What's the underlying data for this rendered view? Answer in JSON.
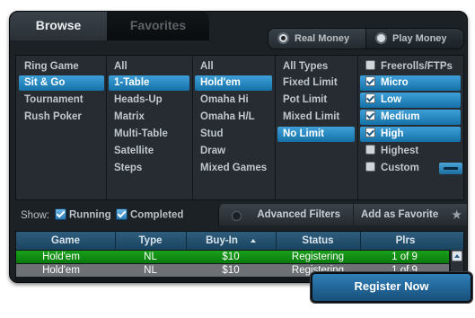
{
  "tabs": {
    "browse": "Browse",
    "favorites": "Favorites"
  },
  "money": {
    "real": "Real Money",
    "play": "Play Money",
    "selected": "real"
  },
  "game_category": [
    "Ring Game",
    "Sit & Go",
    "Tournament",
    "Rush Poker"
  ],
  "table_size": [
    "All",
    "1-Table",
    "Heads-Up",
    "Matrix",
    "Multi-Table",
    "Satellite",
    "Steps"
  ],
  "variant": [
    "All",
    "Hold'em",
    "Omaha Hi",
    "Omaha H/L",
    "Stud",
    "Draw",
    "Mixed Games"
  ],
  "limit": [
    "All Types",
    "Fixed Limit",
    "Pot Limit",
    "Mixed Limit",
    "No Limit"
  ],
  "stakes": {
    "items": [
      {
        "label": "Freerolls/FTPs",
        "checked": false
      },
      {
        "label": "Micro",
        "checked": true
      },
      {
        "label": "Low",
        "checked": true
      },
      {
        "label": "Medium",
        "checked": true
      },
      {
        "label": "High",
        "checked": true
      },
      {
        "label": "Highest",
        "checked": false
      },
      {
        "label": "Custom",
        "checked": false
      }
    ]
  },
  "show": {
    "label": "Show:",
    "running": "Running",
    "completed": "Completed"
  },
  "buttons": {
    "advanced_filters": "Advanced Filters",
    "add_favorite": "Add as Favorite",
    "register": "Register Now"
  },
  "table": {
    "headers": [
      "Game",
      "Type",
      "Buy-In",
      "Status",
      "Plrs"
    ],
    "rows": [
      [
        "Hold'em",
        "NL",
        "$10",
        "Registering",
        "1 of 9"
      ],
      [
        "Hold'em",
        "NL",
        "$10",
        "Registering",
        "1 of 9"
      ]
    ]
  },
  "colors": {
    "selected_blue": "#1f86c4",
    "selected_row": "#12901a"
  }
}
